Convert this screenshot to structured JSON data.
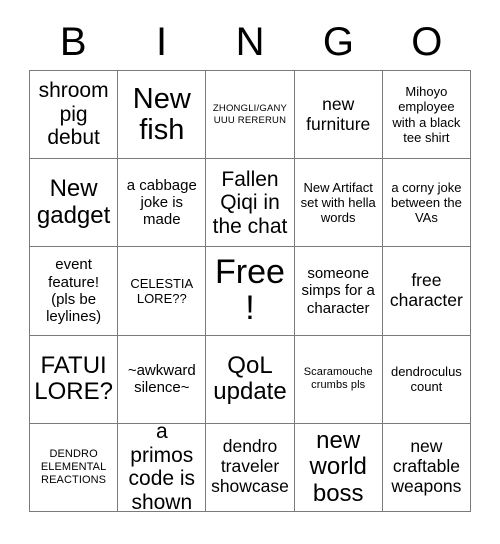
{
  "card": {
    "header_letters": [
      "B",
      "I",
      "N",
      "G",
      "O"
    ],
    "columns": 5,
    "rows": 5,
    "border_color": "#7a7a7a",
    "background_color": "#ffffff",
    "text_color": "#000000",
    "free_space_index": 12,
    "cells": [
      {
        "text": "shroom pig debut",
        "size": "xl"
      },
      {
        "text": "New fish",
        "size": "3xl"
      },
      {
        "text": "ZHONGLI/GANYUUU RERERUN",
        "size": "xxs"
      },
      {
        "text": "new furniture",
        "size": "lg"
      },
      {
        "text": "Mihoyo employee with a black tee shirt",
        "size": "sm"
      },
      {
        "text": "New gadget",
        "size": "2xl"
      },
      {
        "text": "a cabbage joke is made",
        "size": "md"
      },
      {
        "text": "Fallen Qiqi in the chat",
        "size": "xl"
      },
      {
        "text": "New Artifact set with hella words",
        "size": "sm"
      },
      {
        "text": "a corny joke between the VAs",
        "size": "sm"
      },
      {
        "text": "event feature! (pls be leylines)",
        "size": "md"
      },
      {
        "text": "CELESTIA LORE??",
        "size": "sm"
      },
      {
        "text": "Free!",
        "size": "4xl"
      },
      {
        "text": "someone simps for a character",
        "size": "md"
      },
      {
        "text": "free character",
        "size": "lg"
      },
      {
        "text": "FATUI LORE?",
        "size": "2xl"
      },
      {
        "text": "~awkward silence~",
        "size": "md"
      },
      {
        "text": "QoL update",
        "size": "2xl"
      },
      {
        "text": "Scaramouche crumbs pls",
        "size": "xs"
      },
      {
        "text": "dendroculus count",
        "size": "sm"
      },
      {
        "text": "DENDRO ELEMENTAL REACTIONS",
        "size": "xs"
      },
      {
        "text": "a primos code is shown",
        "size": "xl"
      },
      {
        "text": "dendro traveler showcase",
        "size": "lg"
      },
      {
        "text": "new world boss",
        "size": "2xl"
      },
      {
        "text": "new craftable weapons",
        "size": "lg"
      }
    ]
  }
}
